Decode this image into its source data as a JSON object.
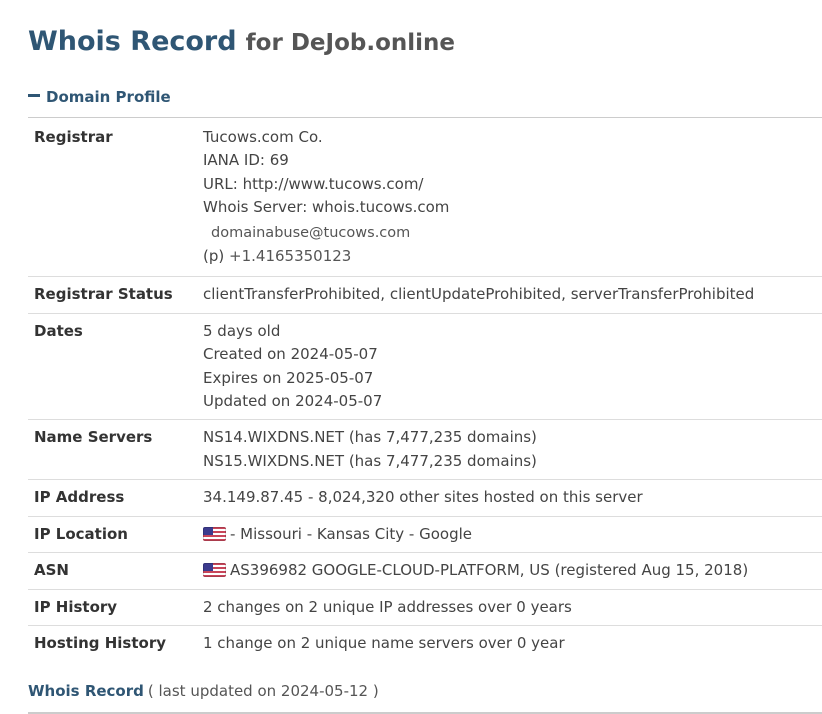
{
  "page": {
    "title": "Whois Record",
    "subtitle": "for DeJob.online"
  },
  "section": {
    "label": "Domain Profile"
  },
  "registrar": {
    "label": "Registrar",
    "name": "Tucows.com Co.",
    "iana": "IANA ID: 69",
    "url": "URL: http://www.tucows.com/",
    "whois_server": "Whois Server: whois.tucows.com",
    "email": "domainabuse@tucows.com",
    "phone_prefix": "(p)",
    "phone": "+1.4165350123"
  },
  "registrar_status": {
    "label": "Registrar Status",
    "value": "clientTransferProhibited, clientUpdateProhibited, serverTransferProhibited"
  },
  "dates": {
    "label": "Dates",
    "age": "5 days old",
    "created": "Created on 2024-05-07",
    "expires": "Expires on 2025-05-07",
    "updated": "Updated on 2024-05-07"
  },
  "name_servers": {
    "label": "Name Servers",
    "items": [
      "NS14.WIXDNS.NET (has 7,477,235 domains)",
      "NS15.WIXDNS.NET (has 7,477,235 domains)"
    ]
  },
  "ip_address": {
    "label": "IP Address",
    "value": "34.149.87.45 - 8,024,320 other sites hosted on this server"
  },
  "ip_location": {
    "label": "IP Location",
    "value": "- Missouri - Kansas City - Google",
    "flag_icon": "us-flag-icon"
  },
  "asn": {
    "label": "ASN",
    "value": "AS396982 GOOGLE-CLOUD-PLATFORM, US (registered Aug 15, 2018)",
    "flag_icon": "us-flag-icon"
  },
  "ip_history": {
    "label": "IP History",
    "value": "2 changes on 2 unique IP addresses over 0 years"
  },
  "hosting_history": {
    "label": "Hosting History",
    "value": "1 change on 2 unique name servers over 0 year"
  },
  "footer": {
    "link": "Whois Record",
    "note": "( last updated on 2024-05-12 )"
  },
  "colors": {
    "accent": "#2f5674",
    "text": "#333333",
    "border": "#dddddd"
  }
}
